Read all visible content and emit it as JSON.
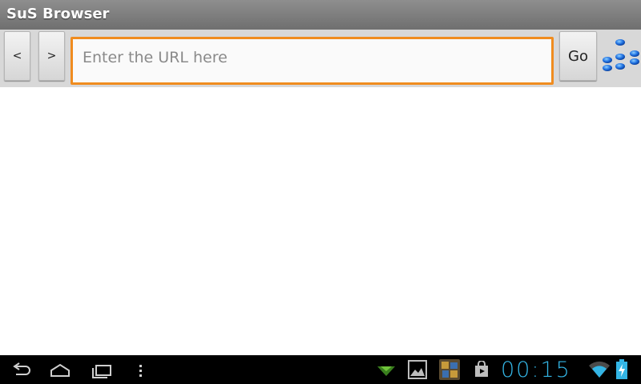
{
  "app": {
    "title": "SuS Browser"
  },
  "toolbar": {
    "back_label": "<",
    "forward_label": ">",
    "go_label": "Go",
    "url_value": "",
    "url_placeholder": "Enter the URL here",
    "logo_icon": "molecule-logo-icon"
  },
  "system_bar": {
    "time": "00:15",
    "icons": [
      "back-icon",
      "home-icon",
      "recent-apps-icon",
      "menu-icon",
      "notification-icon",
      "gallery-icon",
      "game-app-icon",
      "store-bag-icon",
      "wifi-icon",
      "battery-icon"
    ]
  },
  "colors": {
    "title_bar": "#7f7f7f",
    "toolbar": "#d8d8d8",
    "focus_border": "#f08c1f",
    "clock": "#33b5e5",
    "logo": "#1e6fe0"
  }
}
